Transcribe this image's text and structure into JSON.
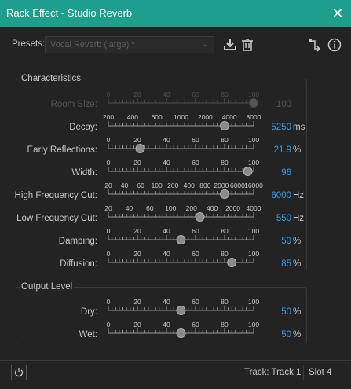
{
  "window": {
    "title": "Rack Effect - Studio Reverb",
    "close_glyph": "✕"
  },
  "presets": {
    "label": "Presets:",
    "selected": "Vocal Reverb (large) *",
    "chevron": "⌄",
    "icons": [
      "save-preset-icon",
      "delete-preset-icon",
      "routing-icon",
      "info-icon"
    ]
  },
  "characteristics": {
    "title": "Characteristics",
    "params": [
      {
        "id": "room-size",
        "label": "Room Size:",
        "value": "100",
        "unit": "",
        "disabled": true,
        "ticks": [
          "0",
          "20",
          "40",
          "60",
          "80",
          "100"
        ],
        "pos": 1.0
      },
      {
        "id": "decay",
        "label": "Decay:",
        "value": "5250",
        "unit": "ms",
        "disabled": false,
        "ticks": [
          "200",
          "400",
          "600",
          "1000",
          "2000",
          "4000",
          "8000"
        ],
        "pos": 0.8
      },
      {
        "id": "early-reflections",
        "label": "Early Reflections:",
        "value": "21.9",
        "unit": "%",
        "disabled": false,
        "ticks": [
          "0",
          "20",
          "40",
          "60",
          "80",
          "100"
        ],
        "pos": 0.219
      },
      {
        "id": "width",
        "label": "Width:",
        "value": "96",
        "unit": "",
        "disabled": false,
        "ticks": [
          "0",
          "20",
          "40",
          "60",
          "80",
          "100"
        ],
        "pos": 0.96
      },
      {
        "id": "high-frequency-cut",
        "label": "High Frequency Cut:",
        "value": "6000",
        "unit": "Hz",
        "disabled": false,
        "ticks": [
          "20",
          "40",
          "60",
          "100",
          "200",
          "400",
          "800",
          "2000",
          "6000",
          "16000"
        ],
        "pos": 0.8
      },
      {
        "id": "low-frequency-cut",
        "label": "Low Frequency Cut:",
        "value": "550",
        "unit": "Hz",
        "disabled": false,
        "ticks": [
          "20",
          "40",
          "60",
          "100",
          "200",
          "400",
          "2000",
          "4000"
        ],
        "pos": 0.63
      },
      {
        "id": "damping",
        "label": "Damping:",
        "value": "50",
        "unit": "%",
        "disabled": false,
        "ticks": [
          "0",
          "20",
          "40",
          "60",
          "80",
          "100"
        ],
        "pos": 0.5
      },
      {
        "id": "diffusion",
        "label": "Diffusion:",
        "value": "85",
        "unit": "%",
        "disabled": false,
        "ticks": [
          "0",
          "20",
          "40",
          "60",
          "80",
          "100"
        ],
        "pos": 0.85
      }
    ]
  },
  "output": {
    "title": "Output Level",
    "params": [
      {
        "id": "dry",
        "label": "Dry:",
        "value": "50",
        "unit": "%",
        "disabled": false,
        "ticks": [
          "0",
          "20",
          "40",
          "60",
          "80",
          "100"
        ],
        "pos": 0.5
      },
      {
        "id": "wet",
        "label": "Wet:",
        "value": "50",
        "unit": "%",
        "disabled": false,
        "ticks": [
          "0",
          "20",
          "40",
          "60",
          "80",
          "100"
        ],
        "pos": 0.5
      }
    ]
  },
  "footer": {
    "track": "Track: Track 1",
    "slot": "Slot 4"
  },
  "colors": {
    "accent": "#1e9e8c",
    "value": "#3a9be8",
    "background": "#232323"
  }
}
